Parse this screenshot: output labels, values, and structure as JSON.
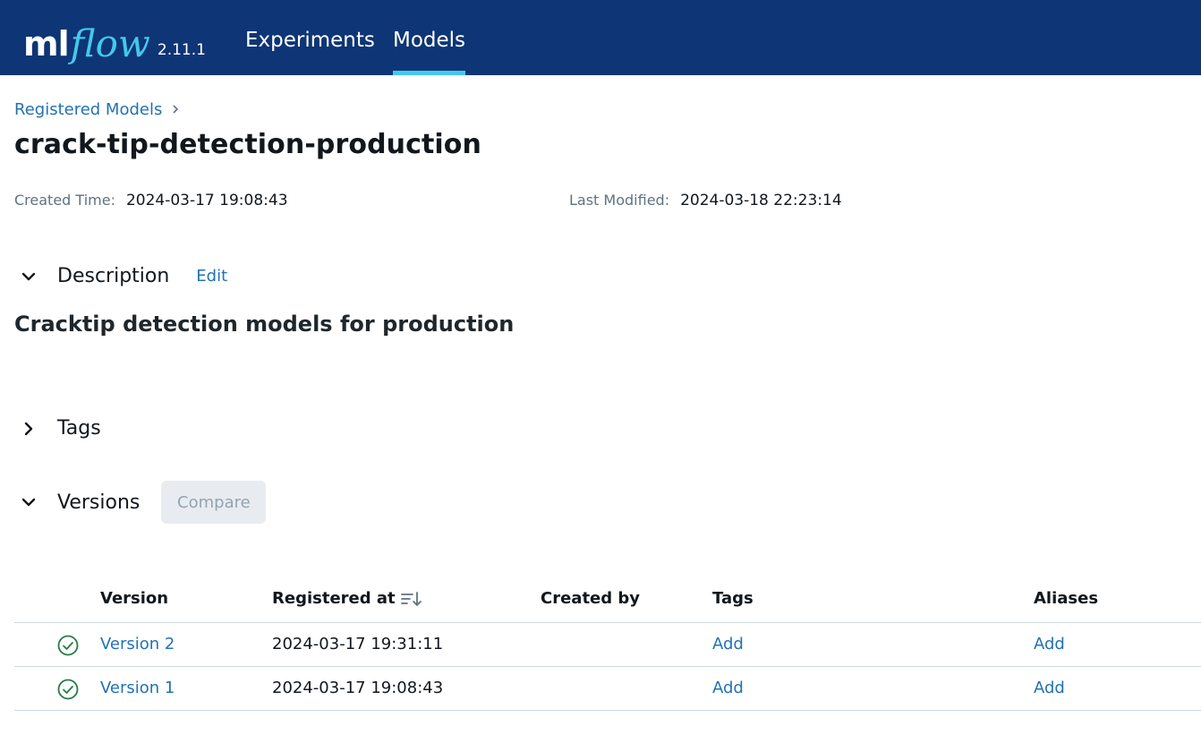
{
  "header": {
    "logo_ml": "ml",
    "logo_flow": "flow",
    "version": "2.11.1",
    "nav": [
      {
        "label": "Experiments",
        "active": false
      },
      {
        "label": "Models",
        "active": true
      }
    ]
  },
  "breadcrumb": {
    "parent": "Registered Models"
  },
  "model": {
    "name": "crack-tip-detection-production",
    "created_label": "Created Time:",
    "created_value": "2024-03-17 19:08:43",
    "modified_label": "Last Modified:",
    "modified_value": "2024-03-18 22:23:14"
  },
  "description": {
    "title": "Description",
    "edit_label": "Edit",
    "text": "Cracktip detection models for production"
  },
  "tags": {
    "title": "Tags"
  },
  "versions": {
    "title": "Versions",
    "compare_label": "Compare",
    "columns": {
      "version": "Version",
      "registered_at": "Registered at",
      "created_by": "Created by",
      "tags": "Tags",
      "aliases": "Aliases"
    },
    "rows": [
      {
        "version": "Version 2",
        "registered_at": "2024-03-17 19:31:11",
        "created_by": "",
        "tags": "Add",
        "aliases": "Add",
        "status": "ready"
      },
      {
        "version": "Version 1",
        "registered_at": "2024-03-17 19:08:43",
        "created_by": "",
        "tags": "Add",
        "aliases": "Add",
        "status": "ready"
      }
    ]
  },
  "colors": {
    "header_bg": "#0e3575",
    "accent": "#43c9ed",
    "link": "#2272b4",
    "status_ok": "#277c43"
  }
}
